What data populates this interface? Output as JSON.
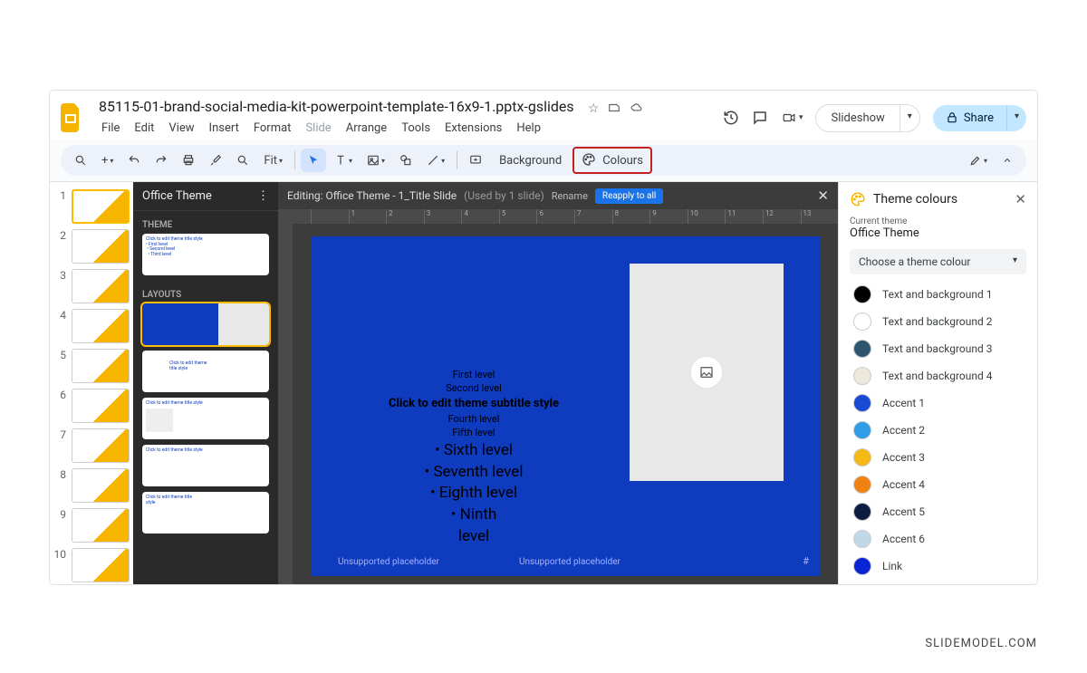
{
  "doc_title": "85115-01-brand-social-media-kit-powerpoint-template-16x9-1.pptx-gslides",
  "menu": [
    "File",
    "Edit",
    "View",
    "Insert",
    "Format",
    "Slide",
    "Arrange",
    "Tools",
    "Extensions",
    "Help"
  ],
  "menu_disabled_index": 5,
  "toolbar": {
    "fit": "Fit",
    "background": "Background",
    "colours": "Colours"
  },
  "buttons": {
    "slideshow": "Slideshow",
    "share": "Share"
  },
  "theme_panel": {
    "title": "Office Theme",
    "section_theme": "THEME",
    "section_layouts": "LAYOUTS"
  },
  "canvas": {
    "editing_prefix": "Editing: Office Theme - 1_Title Slide",
    "used_by": "(Used by 1 slide)",
    "rename": "Rename",
    "reapply": "Reapply to all",
    "ruler_marks": [
      "",
      "1",
      "2",
      "3",
      "4",
      "5",
      "6",
      "7",
      "8",
      "9",
      "10",
      "11",
      "12",
      "13"
    ],
    "text_levels": {
      "l1": "First level",
      "l2": "Second level",
      "subtitle": "Click to edit theme subtitle style",
      "l4": "Fourth level",
      "l5": "Fifth level",
      "l6": "• Sixth level",
      "l7": "• Seventh level",
      "l8": "• Eighth level",
      "l9a": "• Ninth",
      "l9b": "level"
    },
    "unsupported": "Unsupported placeholder",
    "hash": "#"
  },
  "right_panel": {
    "title": "Theme colours",
    "subhead": "Current theme",
    "theme_name": "Office Theme",
    "dropdown": "Choose a theme colour",
    "colors": [
      {
        "label": "Text and background 1",
        "hex": "#000000"
      },
      {
        "label": "Text and background 2",
        "hex": "#ffffff"
      },
      {
        "label": "Text and background 3",
        "hex": "#2e556e"
      },
      {
        "label": "Text and background 4",
        "hex": "#ece8db"
      },
      {
        "label": "Accent 1",
        "hex": "#1a49d6"
      },
      {
        "label": "Accent 2",
        "hex": "#2f9de8"
      },
      {
        "label": "Accent 3",
        "hex": "#f6b814"
      },
      {
        "label": "Accent 4",
        "hex": "#f08214"
      },
      {
        "label": "Accent 5",
        "hex": "#0d1d42"
      },
      {
        "label": "Accent 6",
        "hex": "#bfd9e8"
      },
      {
        "label": "Link",
        "hex": "#0b24d6"
      }
    ]
  },
  "slide_numbers": [
    1,
    2,
    3,
    4,
    5,
    6,
    7,
    8,
    9,
    10
  ],
  "watermark": "SLIDEMODEL.COM"
}
